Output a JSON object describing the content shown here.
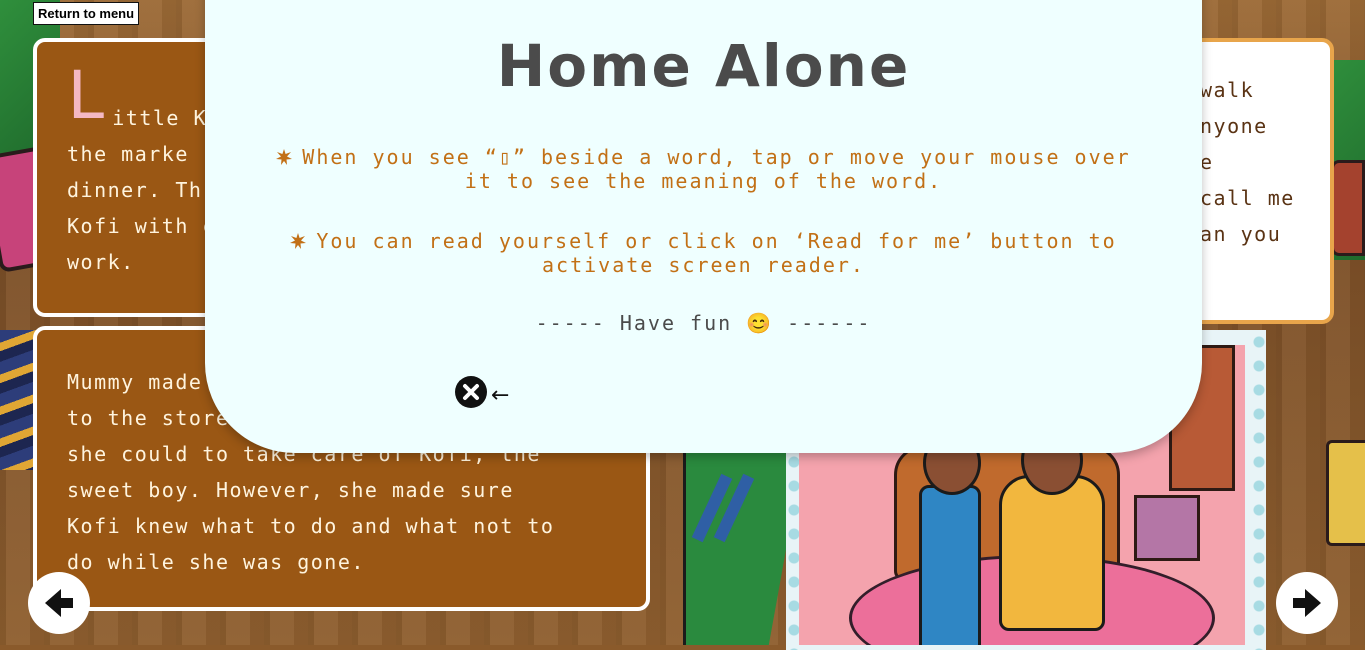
{
  "toolbar": {
    "return_label": "Return to menu"
  },
  "story": {
    "top_card": {
      "drop_cap": "L",
      "lines": [
        "ittle Ko",
        "the marke",
        "dinner. Th",
        "Kofi with c",
        "work."
      ]
    },
    "bottom_card": {
      "lines": [
        "Mummy made a ho",
        "to the store and ret",
        "she could to take care of Kofi, the",
        "sweet boy. However, she made sure",
        "Kofi knew what to do and what not to",
        "do while she was gone."
      ]
    },
    "right_card": {
      "lines": [
        "walk",
        "nyone",
        "e",
        "call me",
        "an you"
      ]
    }
  },
  "modal": {
    "title": "Home Alone",
    "instructions": [
      "When you see “▯” beside a word, tap or move your mouse over it to see the meaning of the word.",
      "You can read yourself or click on ‘Read for me’ button to activate screen reader."
    ],
    "have_fun": "----- Have fun 😊 ------",
    "close_arrow": "←"
  },
  "icons": {
    "bullet": "burst-icon",
    "close": "close-icon",
    "prev": "arrow-left-icon",
    "next": "arrow-right-icon"
  },
  "colors": {
    "card_brown": "#9a5714",
    "modal_bg": "#efffff",
    "instruction_orange": "#c27016",
    "title_gray": "#4b4b4b"
  }
}
